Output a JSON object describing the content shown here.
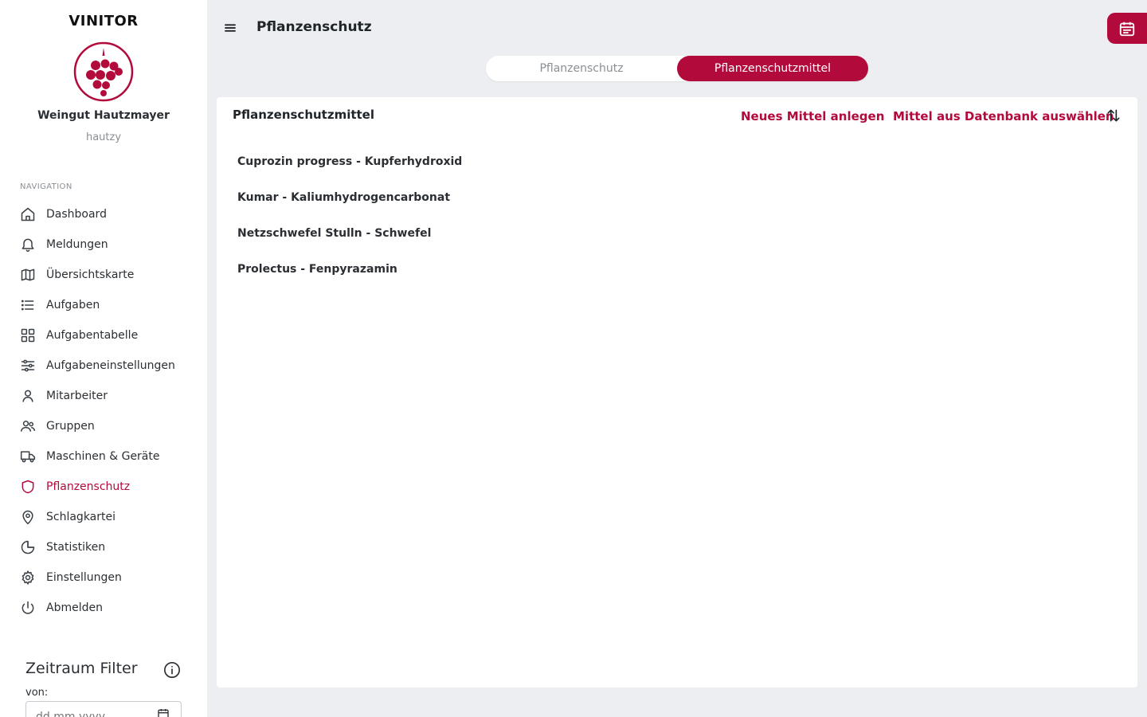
{
  "app": {
    "brand": "VINITOR"
  },
  "profile": {
    "company": "Weingut Hautzmayer",
    "username": "hautzy"
  },
  "sidebar": {
    "heading": "NAVIGATION",
    "items": [
      {
        "label": "Dashboard",
        "icon": "home-icon"
      },
      {
        "label": "Meldungen",
        "icon": "bell-icon"
      },
      {
        "label": "Übersichtskarte",
        "icon": "map-icon"
      },
      {
        "label": "Aufgaben",
        "icon": "list-icon"
      },
      {
        "label": "Aufgabentabelle",
        "icon": "grid-icon"
      },
      {
        "label": "Aufgabeneinstellungen",
        "icon": "sliders-icon"
      },
      {
        "label": "Mitarbeiter",
        "icon": "user-icon"
      },
      {
        "label": "Gruppen",
        "icon": "users-icon"
      },
      {
        "label": "Maschinen & Geräte",
        "icon": "truck-icon"
      },
      {
        "label": "Pflanzenschutz",
        "icon": "shield-icon",
        "active": true
      },
      {
        "label": "Schlagkartei",
        "icon": "map-pin-icon"
      },
      {
        "label": "Statistiken",
        "icon": "pie-chart-icon"
      },
      {
        "label": "Einstellungen",
        "icon": "gear-icon"
      },
      {
        "label": "Abmelden",
        "icon": "power-icon"
      }
    ]
  },
  "filter": {
    "title": "Zeitraum Filter",
    "from_label": "von:",
    "from_placeholder": "dd.mm.yyyy"
  },
  "header": {
    "title": "Pflanzenschutz"
  },
  "tabs": [
    {
      "label": "Pflanzenschutz",
      "active": false
    },
    {
      "label": "Pflanzenschutzmittel",
      "active": true
    }
  ],
  "card": {
    "title": "Pflanzenschutzmittel",
    "action_new": "Neues Mittel anlegen",
    "action_db": "Mittel aus Datenbank auswählen",
    "items": [
      "Cuprozin progress - Kupferhydroxid",
      "Kumar - Kaliumhydrogencarbonat",
      "Netzschwefel Stulln - Schwefel",
      "Prolectus - Fenpyrazamin"
    ]
  },
  "colors": {
    "accent": "#b30a3c",
    "background": "#eceef1",
    "text": "#1f2429",
    "muted": "#8a8f94"
  }
}
